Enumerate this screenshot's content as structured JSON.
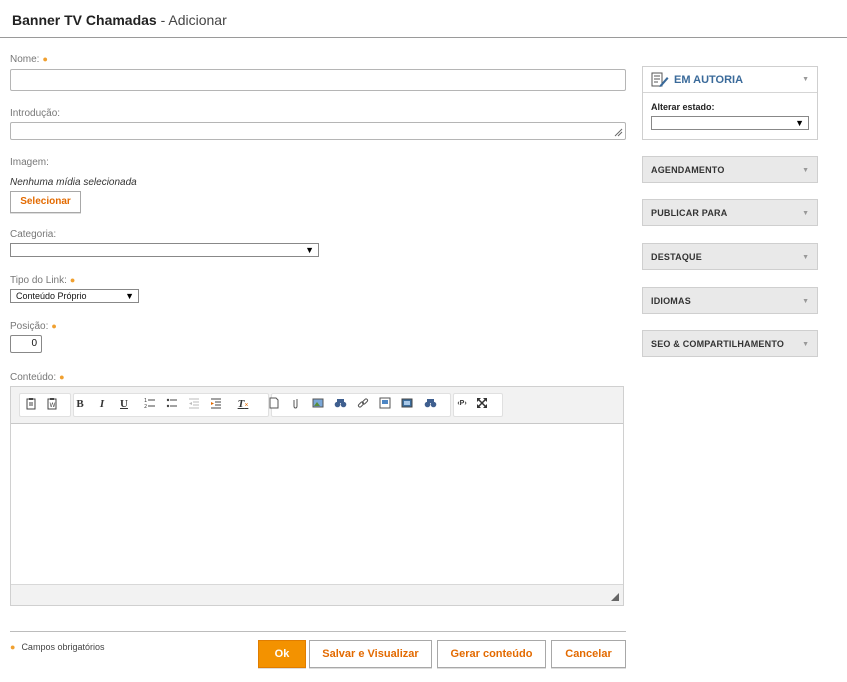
{
  "header": {
    "title": "Banner TV Chamadas",
    "subtitle": "- Adicionar"
  },
  "form": {
    "nome_label": "Nome:",
    "nome_value": "",
    "introducao_label": "Introdução:",
    "introducao_value": "",
    "imagem_label": "Imagem:",
    "imagem_empty": "Nenhuma mídia selecionada",
    "selecionar_label": "Selecionar",
    "categoria_label": "Categoria:",
    "categoria_value": "",
    "tipo_link_label": "Tipo do Link:",
    "tipo_link_value": "Conteúdo Próprio",
    "posicao_label": "Posição:",
    "posicao_value": "0",
    "conteudo_label": "Conteúdo:",
    "required_mark": "●"
  },
  "toolbar": {
    "bold": "B",
    "italic": "I",
    "underline": "U",
    "clear_format": "T"
  },
  "footer": {
    "required_note": "Campos obrigatórios",
    "ok_label": "Ok",
    "salvar_label": "Salvar e Visualizar",
    "gerar_label": "Gerar conteúdo",
    "cancelar_label": "Cancelar"
  },
  "sidebar": {
    "status_title": "EM AUTORIA",
    "alterar_estado_label": "Alterar estado:",
    "alterar_estado_value": "",
    "panels": [
      {
        "label": "AGENDAMENTO"
      },
      {
        "label": "PUBLICAR PARA"
      },
      {
        "label": "DESTAQUE"
      },
      {
        "label": "IDIOMAS"
      },
      {
        "label": "SEO & COMPARTILHAMENTO"
      }
    ]
  },
  "colors": {
    "accent": "#f39200",
    "link": "#e36a00",
    "status_title": "#3a6a9a"
  }
}
